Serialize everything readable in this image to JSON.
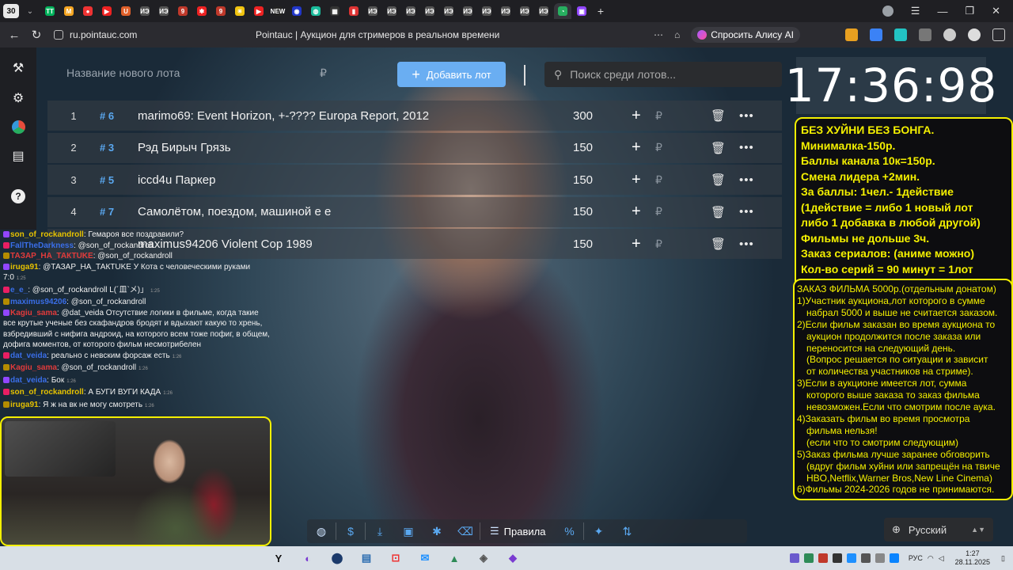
{
  "browser": {
    "tab_count": "30",
    "tabs": [
      {
        "label": "TT",
        "color": "#00b35c"
      },
      {
        "label": "M",
        "color": "#f5a623"
      },
      {
        "label": "●",
        "color": "#e33"
      },
      {
        "label": "▶",
        "color": "#e22"
      },
      {
        "label": "U",
        "color": "#e0602a"
      },
      {
        "label": "ИЭ",
        "color": "#555"
      },
      {
        "label": "ИЭ",
        "color": "#555"
      },
      {
        "label": "9",
        "color": "#c0392b"
      },
      {
        "label": "✱",
        "color": "#e22"
      },
      {
        "label": "9",
        "color": "#c0392b"
      },
      {
        "label": "☀",
        "color": "#f1c40f"
      },
      {
        "label": "▶",
        "color": "#e22"
      },
      {
        "label": "NEW",
        "color": "#222"
      },
      {
        "label": "◉",
        "color": "#2237c9"
      },
      {
        "label": "◍",
        "color": "#1abc9c"
      },
      {
        "label": "▦",
        "color": "#333"
      },
      {
        "label": "▮",
        "color": "#d33"
      },
      {
        "label": "ИЭ",
        "color": "#555"
      },
      {
        "label": "ИЭ",
        "color": "#555"
      },
      {
        "label": "ИЭ",
        "color": "#555"
      },
      {
        "label": "ИЭ",
        "color": "#555"
      },
      {
        "label": "ИЭ",
        "color": "#555"
      },
      {
        "label": "ИЭ",
        "color": "#555"
      },
      {
        "label": "ИЭ",
        "color": "#555"
      },
      {
        "label": "ИЭ",
        "color": "#555"
      },
      {
        "label": "ИЭ",
        "color": "#555"
      },
      {
        "label": "ИЭ",
        "color": "#555"
      },
      {
        "label": "◔",
        "color": "#27ae60"
      },
      {
        "label": "▣",
        "color": "#9146ff"
      }
    ],
    "url": "ru.pointauc.com",
    "page_title": "Pointauc | Аукцион для стримеров в реальном времени",
    "alice_label": "Спросить Алису AI"
  },
  "auction": {
    "new_lot_placeholder": "Название нового лота",
    "currency_symbol": "₽",
    "add_button_label": "Добавить лот",
    "search_placeholder": "Поиск среди лотов...",
    "timer": "17:36:98",
    "lots": [
      {
        "num": "1",
        "id": "# 6",
        "name": "marimo69: Event Horizon, +-???? Europa Report, 2012",
        "amount": "300"
      },
      {
        "num": "2",
        "id": "# 3",
        "name": "Рэд Бирыч Грязь",
        "amount": "150"
      },
      {
        "num": "3",
        "id": "# 5",
        "name": "iccd4u Паркер",
        "amount": "150"
      },
      {
        "num": "4",
        "id": "# 7",
        "name": " Самолётом, поездом, машиной е е",
        "amount": "150"
      },
      {
        "num": "",
        "id": "",
        "name": "maximus94206 Violent Cop 1989",
        "amount": "150"
      }
    ],
    "rules_button_label": "Правила",
    "language": "Русский"
  },
  "overlay_rules_1": [
    "БЕЗ ХУЙНИ БЕЗ БОНГА.",
    "Минималка-150р.",
    "Баллы канала 10к=150р.",
    "Смена лидера +2мин.",
    "За баллы: 1чел.- 1действие",
    "(1действие = либо 1 новый лот",
    " либо 1 добавка в любой другой)",
    "Фильмы не дольше 3ч.",
    "Заказ сериалов: (аниме можно)",
    "Кол-во серий = 90 минут = 1лот"
  ],
  "overlay_rules_2": [
    "ЗАКАЗ ФИЛЬМА 5000р.(отдельным донатом)",
    "1)Участник аукциона,лот которого в сумме",
    "набрал 5000 и выше не считается заказом.",
    "2)Если фильм заказан во время аукциона то",
    "аукцион продолжится после заказа или",
    "переносится на следующий день.",
    "(Вопрос решается по ситуации и зависит",
    "от количества участников на стриме).",
    "3)Если в аукционе имеется лот, сумма",
    "которого выше заказа то заказ фильма",
    "невозможен.Если что смотрим после аука.",
    "4)Заказать фильм во время просмотра",
    "фильма нельзя!",
    "(если что то смотрим следующим)",
    "5)Заказ фильма лучше заранее обговорить",
    "(вдруг фильм хуйни или запрещён на твиче",
    "HBO,Netflix,Warner Bros,New Line Cinema)",
    "6)Фильмы 2024-2026 годов не принимаются."
  ],
  "chat": [
    {
      "user": "son_of_rockandroll",
      "color": "#e6c200",
      "text": ": Гемароя все поздравили?",
      "ts": ""
    },
    {
      "user": "FallTheDarkness",
      "color": "#3a6ee8",
      "text": ": @son_of_rockandroll",
      "ts": ""
    },
    {
      "user": "ТАЗАР_НА_ТАКТUKE",
      "color": "#e23b3b",
      "text": ": @son_of_rockandroll",
      "ts": ""
    },
    {
      "user": "iruga91",
      "color": "#e6c200",
      "text": ": @ТАЗАР_НА_ТАКТUKE У Кота с человеческими руками 7:0",
      "ts": "1:25"
    },
    {
      "user": "e_e_",
      "color": "#3a6ee8",
      "text": ": @son_of_rockandroll L(´皿`メ)」",
      "ts": "1:25"
    },
    {
      "user": "maximus94206",
      "color": "#3a6ee8",
      "text": ": @son_of_rockandroll",
      "ts": ""
    },
    {
      "user": "Kagiu_sama",
      "color": "#e23b3b",
      "text": ": @dat_veida Отсутствие логики в фильме, когда такие все крутые ученые без скафандров бродят и вдыхают какую то хрень, взбредивший с нифига андроид, на которого всем тоже пофиг, в общем, дофига моментов, от которого фильм несмотрибелен",
      "ts": ""
    },
    {
      "user": "dat_veida",
      "color": "#3a6ee8",
      "text": ": реально с невским форсаж есть",
      "ts": "1:26"
    },
    {
      "user": "Kagiu_sama",
      "color": "#e23b3b",
      "text": ": @son_of_rockandroll",
      "ts": "1:26"
    },
    {
      "user": "dat_veida",
      "color": "#3a6ee8",
      "text": ": Бок",
      "ts": "1:26"
    },
    {
      "user": "son_of_rockandroll",
      "color": "#e6c200",
      "text": ": А БУГИ ВУГИ КАДА",
      "ts": "1:26"
    },
    {
      "user": "iruga91",
      "color": "#e6c200",
      "text": ": Я ж на вк не могу смотреть",
      "ts": "1:26"
    }
  ],
  "taskbar": {
    "apps": [
      "⊞",
      "⌕",
      "▭",
      "◔",
      "Y",
      "◐",
      "⬤",
      "▤",
      "⊡",
      "✉",
      "▲",
      "◈",
      "◆",
      "◇"
    ],
    "lang": "РУС",
    "time": "1:27",
    "date": "28.11.2025"
  }
}
